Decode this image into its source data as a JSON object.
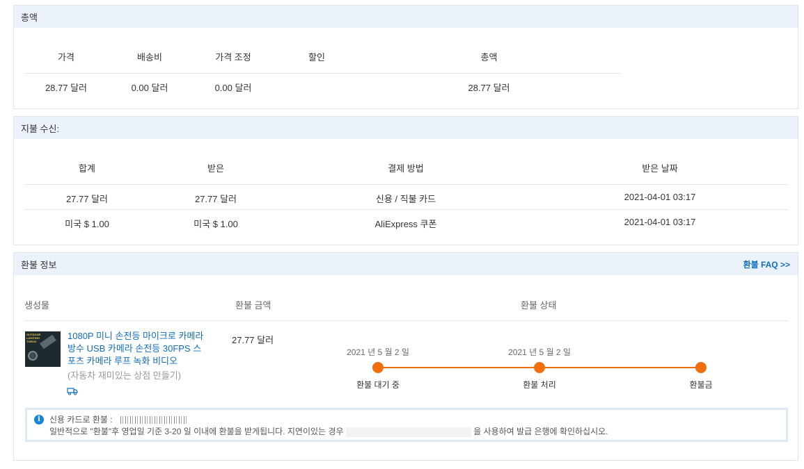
{
  "total_section": {
    "title": "총액",
    "headers": [
      "가격",
      "배송비",
      "가격 조정",
      "할인",
      "총액"
    ],
    "values": [
      "28.77 달러",
      "0.00 달러",
      "0.00 달러",
      "",
      "28.77 달러"
    ]
  },
  "payment_section": {
    "title": "지불 수신:",
    "headers": [
      "합계",
      "받은",
      "결제 방법",
      "받은 날짜"
    ],
    "rows": [
      [
        "27.77 달러",
        "27.77 달러",
        "신용 / 직불 카드",
        "2021-04-01 03:17"
      ],
      [
        "미국 $ 1.00",
        "미국 $ 1.00",
        "AliExpress 쿠폰",
        "2021-04-01 03:17"
      ]
    ]
  },
  "refund_section": {
    "title": "환불 정보",
    "faq_link": "환불 FAQ >>",
    "headers": [
      "생성물",
      "환불 금액",
      "환불 상태"
    ],
    "product": {
      "name_line1": "1080P 미니 손전등 마이크로 카메라",
      "name_line2": "방수 USB 카메라 손전등 30FPS 스",
      "name_line3": "포츠 카메라 루프 녹화 비디오",
      "variant": "(자동차 재미있는 상점 만들기)",
      "amount": "27.77 달러",
      "thumb_text": "OUTDOOR LIGHTING TORCH"
    },
    "timeline": {
      "dates": [
        "2021 년 5 월 2 일",
        "2021 년 5 월 2 일"
      ],
      "steps": [
        "환불 대기 중",
        "환불 처리",
        "환불금"
      ],
      "color": "#f06f0c"
    },
    "notice": {
      "line1": "신용 카드로 환불 :",
      "line2_part1": "일반적으로 \"환불\"후 영업일 기준 3-20 일 이내에 환불을 받게됩니다. 지연이있는 경우",
      "line2_part2": "을 사용하여 발급 은행에 확인하십시오."
    }
  },
  "colors": {
    "header_bg": "#ebf2fa",
    "link": "#0f6cbd",
    "accent": "#f06f0c",
    "info": "#1a84d8"
  }
}
